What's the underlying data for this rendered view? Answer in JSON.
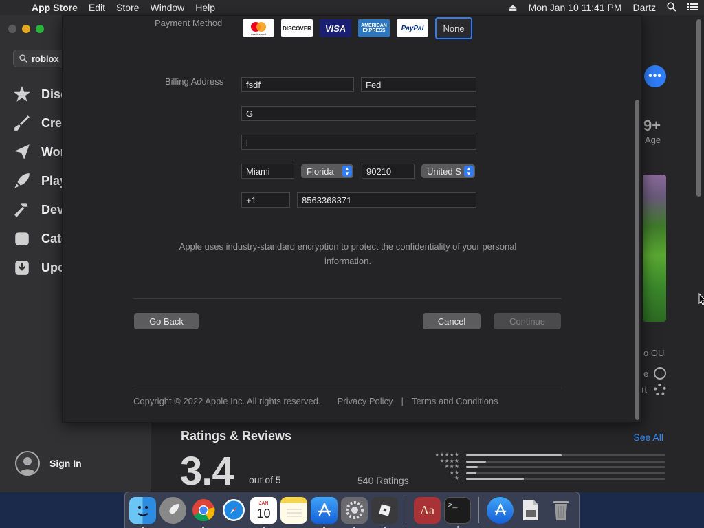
{
  "menubar": {
    "app_name": "App Store",
    "items": [
      "Edit",
      "Store",
      "Window",
      "Help"
    ],
    "datetime": "Mon Jan 10  11:41 PM",
    "user": "Dartz"
  },
  "sidebar": {
    "search_value": "roblox",
    "items": [
      {
        "label": "Disc",
        "icon": "star-icon"
      },
      {
        "label": "Crea",
        "icon": "brush-icon"
      },
      {
        "label": "Wor",
        "icon": "paperplane-icon"
      },
      {
        "label": "Play",
        "icon": "rocket-icon"
      },
      {
        "label": "Dev",
        "icon": "hammer-icon"
      },
      {
        "label": "Cate",
        "icon": "categories-icon"
      },
      {
        "label": "Upo",
        "icon": "updates-icon"
      }
    ],
    "sign_in": "Sign In"
  },
  "background": {
    "age_value": "9+",
    "age_label": "Age",
    "side_text_1": "o OU",
    "side_text_2": "e",
    "side_text_3": "rt",
    "ratings_title": "Ratings & Reviews",
    "see_all": "See All",
    "score": "3.4",
    "out_of": "out of 5",
    "ratings_count": "540 Ratings",
    "star_rows": [
      "★★★★★",
      "★★★★",
      "★★★",
      "★★",
      "★"
    ],
    "rating_distribution": [
      0.48,
      0.1,
      0.06,
      0.05,
      0.29
    ]
  },
  "sheet": {
    "payment_label": "Payment Method",
    "payment_methods": [
      "mastercard",
      "DISCOVER",
      "VISA",
      "AMERICAN EXPRESS",
      "PayPal",
      "None"
    ],
    "selected_payment": "None",
    "billing_label": "Billing Address",
    "first_name": "fsdf",
    "last_name": "Fed",
    "street": "G",
    "street2": "l",
    "city": "Miami",
    "state": "Florida",
    "zip": "90210",
    "country": "United S",
    "phone_code": "+1",
    "phone": "8563368371",
    "info_line1": "Apple uses industry-standard encryption to protect the confidentiality of your personal",
    "info_line2": "information.",
    "go_back": "Go Back",
    "cancel": "Cancel",
    "continue": "Continue",
    "copyright": "Copyright © 2022 Apple Inc. All rights reserved.",
    "privacy": "Privacy Policy",
    "sep": "|",
    "terms": "Terms and Conditions"
  },
  "dock": {
    "calendar_month": "JAN",
    "calendar_day": "10",
    "dictionary_label": "Aa",
    "terminal_prompt": ">_"
  }
}
